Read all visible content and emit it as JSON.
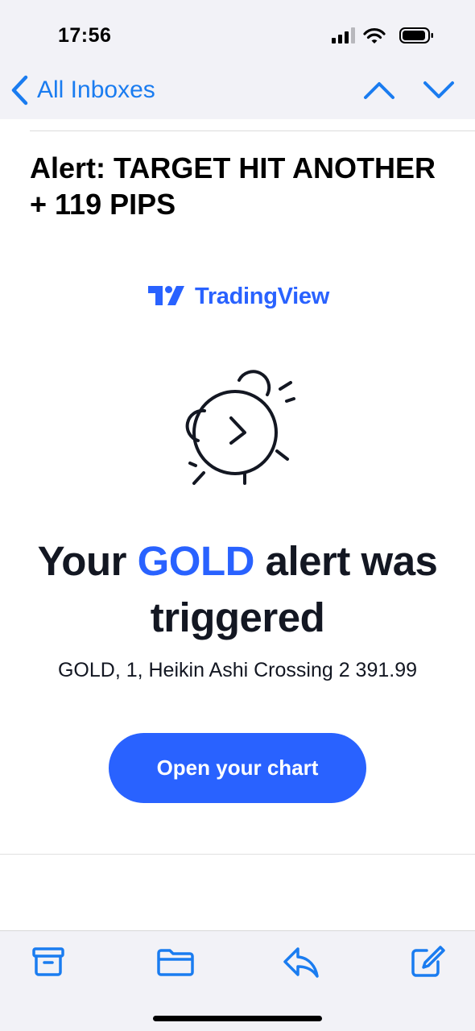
{
  "status_bar": {
    "time": "17:56",
    "icons": [
      "cellular-signal-icon",
      "wifi-icon",
      "battery-icon"
    ]
  },
  "nav": {
    "back_label": "All Inboxes",
    "icons": [
      "chevron-left-icon",
      "chevron-up-icon",
      "chevron-down-icon"
    ]
  },
  "email": {
    "subject": "Alert: TARGET HIT ANOTHER + 119 PIPS",
    "logo_name": "TradingView",
    "headline_prefix": "Your",
    "headline_symbol": "GOLD",
    "headline_suffix": "alert was triggered",
    "detail": "GOLD, 1, Heikin Ashi Crossing 2 391.99",
    "cta_label": "Open your chart"
  },
  "toolbar": {
    "icons": [
      "archive-icon",
      "folder-icon",
      "reply-icon",
      "compose-icon"
    ]
  },
  "colors": {
    "ios_blue": "#1a7cf0",
    "brand_blue": "#2962ff",
    "headline_text": "#131722",
    "chrome_bg": "#f2f2f7"
  }
}
